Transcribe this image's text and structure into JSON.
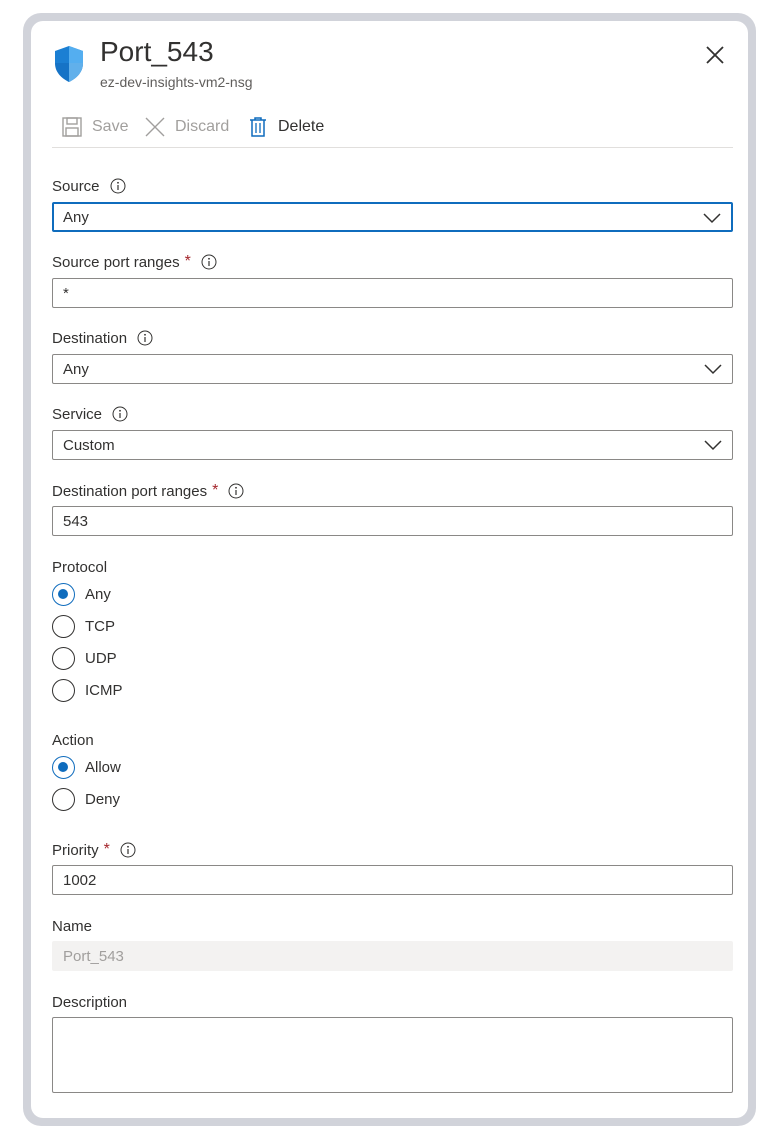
{
  "header": {
    "title": "Port_543",
    "subtitle": "ez-dev-insights-vm2-nsg",
    "icon": "shield-icon",
    "close_icon": "close-icon"
  },
  "toolbar": {
    "save_label": "Save",
    "discard_label": "Discard",
    "delete_label": "Delete"
  },
  "form": {
    "source": {
      "label": "Source",
      "value": "Any"
    },
    "source_port_ranges": {
      "label": "Source port ranges",
      "required": "*",
      "value": "*"
    },
    "destination": {
      "label": "Destination",
      "value": "Any"
    },
    "service": {
      "label": "Service",
      "value": "Custom"
    },
    "destination_port_ranges": {
      "label": "Destination port ranges",
      "required": "*",
      "value": "543"
    },
    "protocol": {
      "label": "Protocol",
      "options": [
        "Any",
        "TCP",
        "UDP",
        "ICMP"
      ],
      "selected": "Any"
    },
    "action": {
      "label": "Action",
      "options": [
        "Allow",
        "Deny"
      ],
      "selected": "Allow"
    },
    "priority": {
      "label": "Priority",
      "required": "*",
      "value": "1002"
    },
    "name": {
      "label": "Name",
      "value": "Port_543"
    },
    "description": {
      "label": "Description",
      "value": ""
    }
  },
  "colors": {
    "accent": "#0f6cbd",
    "required": "#a4262c",
    "frame": "#d1d3da"
  }
}
